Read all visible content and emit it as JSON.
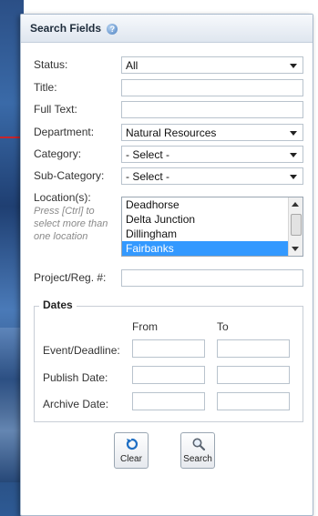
{
  "panel": {
    "title": "Search Fields"
  },
  "fields": {
    "status": {
      "label": "Status:",
      "value": "All"
    },
    "title": {
      "label": "Title:",
      "value": ""
    },
    "full_text": {
      "label": "Full Text:",
      "value": ""
    },
    "department": {
      "label": "Department:",
      "value": "Natural Resources"
    },
    "category": {
      "label": "Category:",
      "value": "- Select -"
    },
    "sub_category": {
      "label": "Sub-Category:",
      "value": "- Select -"
    },
    "location": {
      "label": "Location(s):",
      "hint": "Press [Ctrl] to select more than one location",
      "options": [
        "Deadhorse",
        "Delta Junction",
        "Dillingham",
        "Fairbanks"
      ],
      "selected": "Fairbanks"
    },
    "project_reg": {
      "label": "Project/Reg. #:",
      "value": ""
    }
  },
  "dates": {
    "title": "Dates",
    "from_label": "From",
    "to_label": "To",
    "rows": [
      {
        "label": "Event/Deadline:"
      },
      {
        "label": "Publish Date:"
      },
      {
        "label": "Archive Date:"
      }
    ]
  },
  "buttons": {
    "clear": "Clear",
    "search": "Search"
  },
  "colors": {
    "selection": "#3399ff",
    "accent_red": "#c8252c",
    "header_bg": "#dfe6ef"
  }
}
